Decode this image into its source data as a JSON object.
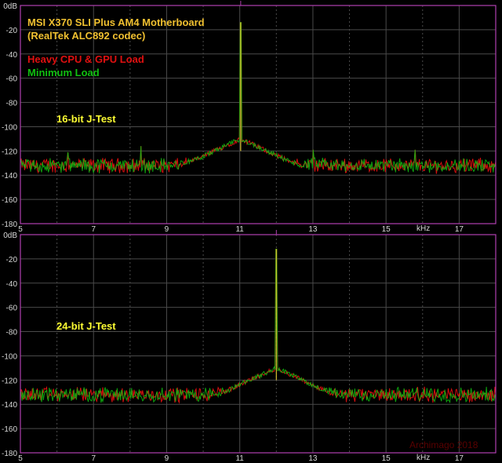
{
  "colors": {
    "background": "#000000",
    "frame": "#b040b0",
    "grid": "#4a4a4a",
    "text": "#d8d8d8",
    "annotation": "#ffff33",
    "series_heavy": "#e01010",
    "series_min": "#10c010",
    "series_pair_top": "#d8c030",
    "watermark": "#5a0000"
  },
  "chart_data": [
    {
      "type": "line",
      "title": "MSI X370 SLI Plus AM4 Motherboard",
      "subtitle": "(RealTek ALC892 codec)",
      "annotation": "16-bit J-Test",
      "xunit": "kHz",
      "xlim": [
        5,
        18
      ],
      "ylim": [
        -180,
        0
      ],
      "xticks": [
        "5",
        "7",
        "9",
        "11",
        "13",
        "15",
        "17"
      ],
      "yticks": [
        "0dB",
        "-20",
        "-40",
        "-60",
        "-80",
        "-100",
        "-120",
        "-140",
        "-160",
        "-180"
      ],
      "grid": true,
      "legend_placement": "top-left",
      "series": [
        {
          "name": "Heavy CPU & GPU Load",
          "color": "#e01010",
          "noise_floor_db": -132,
          "peaks": [
            {
              "x": 11.025,
              "y": -14
            },
            {
              "x": 6.3,
              "y": -121
            },
            {
              "x": 8.3,
              "y": -116
            },
            {
              "x": 13.0,
              "y": -119
            },
            {
              "x": 15.8,
              "y": -119
            }
          ]
        },
        {
          "name": "Minimum Load",
          "color": "#10c010",
          "noise_floor_db": -132,
          "peaks": [
            {
              "x": 11.025,
              "y": -14
            },
            {
              "x": 6.3,
              "y": -121
            },
            {
              "x": 8.3,
              "y": -116
            },
            {
              "x": 13.0,
              "y": -119
            },
            {
              "x": 15.8,
              "y": -119
            }
          ]
        }
      ]
    },
    {
      "type": "line",
      "annotation": "24-bit J-Test",
      "watermark": "Archimago 2018",
      "xunit": "kHz",
      "xlim": [
        5,
        18
      ],
      "ylim": [
        -180,
        0
      ],
      "xticks": [
        "5",
        "7",
        "9",
        "11",
        "13",
        "15",
        "17"
      ],
      "yticks": [
        "0dB",
        "-20",
        "-40",
        "-60",
        "-80",
        "-100",
        "-120",
        "-140",
        "-160",
        "-180"
      ],
      "grid": true,
      "series": [
        {
          "color": "#e01010",
          "noise_floor_db": -132,
          "peaks": [
            {
              "x": 12.0,
              "y": -12
            }
          ]
        },
        {
          "color": "#10c010",
          "noise_floor_db": -132,
          "peaks": [
            {
              "x": 12.0,
              "y": -12
            }
          ]
        }
      ]
    }
  ]
}
